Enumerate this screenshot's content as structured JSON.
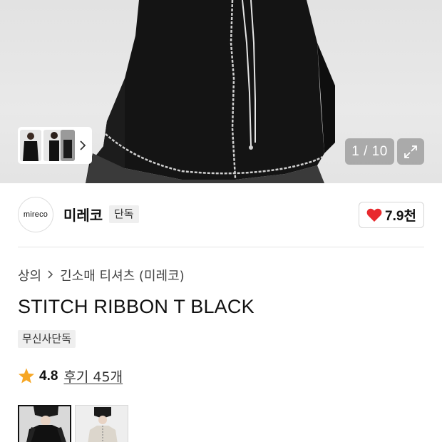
{
  "gallery": {
    "counter": "1 / 10",
    "icons": {
      "next": "chevron-right-icon",
      "expand": "expand-icon"
    }
  },
  "brand": {
    "logo_text": "mireco",
    "name": "미레코",
    "badge": "단독",
    "like_count": "7.9천",
    "like_color": "#e8292d"
  },
  "product": {
    "breadcrumb": [
      "상의",
      "긴소매 티셔츠 (미레코)"
    ],
    "title": "STITCH RIBBON T BLACK",
    "exclusive_badge": "무신사단독",
    "rating": "4.8",
    "review_link": "후기 45개",
    "star_color": "#f6a623"
  }
}
